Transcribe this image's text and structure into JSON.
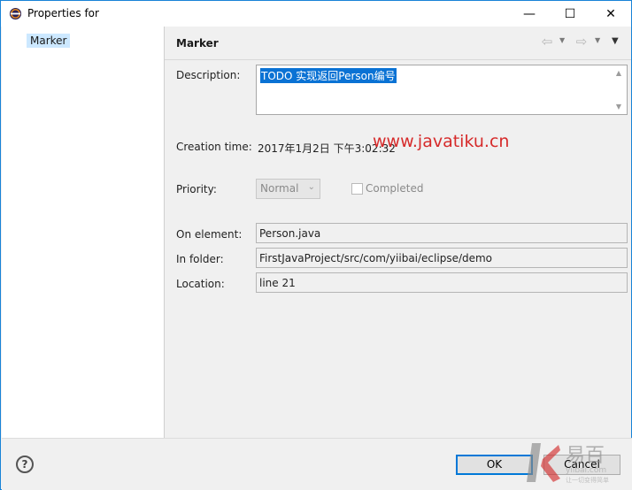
{
  "window": {
    "title": "Properties for",
    "controls": {
      "minimize": "—",
      "maximize": "☐",
      "close": "✕"
    }
  },
  "tree": {
    "items": [
      {
        "label": "Marker",
        "selected": true
      }
    ]
  },
  "page": {
    "title": "Marker",
    "nav": {
      "back": "⇦",
      "forward": "⇨",
      "dropdown": "▼",
      "menu": "▼"
    }
  },
  "fields": {
    "description": {
      "label": "Description:",
      "value": "TODO 实现返回Person编号"
    },
    "creation_time": {
      "label": "Creation time:",
      "value": "2017年1月2日 下午3:02:32"
    },
    "priority": {
      "label": "Priority:",
      "value": "Normal",
      "completed_label": "Completed"
    },
    "on_element": {
      "label": "On element:",
      "value": "Person.java"
    },
    "in_folder": {
      "label": "In folder:",
      "value": "FirstJavaProject/src/com/yiibai/eclipse/demo"
    },
    "location": {
      "label": "Location:",
      "value": "line 21"
    }
  },
  "watermark": {
    "text": "www.javatiku.cn"
  },
  "buttons": {
    "help": "?",
    "ok": "OK",
    "cancel": "Cancel"
  },
  "logo": {
    "text": "易百",
    "sub": "yiibai.com",
    "tagline": "让一切变得简单"
  },
  "colors": {
    "selection": "#cce8ff",
    "text_selection": "#0a72d4",
    "accent": "#0078d7",
    "watermark": "#d62a2a"
  }
}
